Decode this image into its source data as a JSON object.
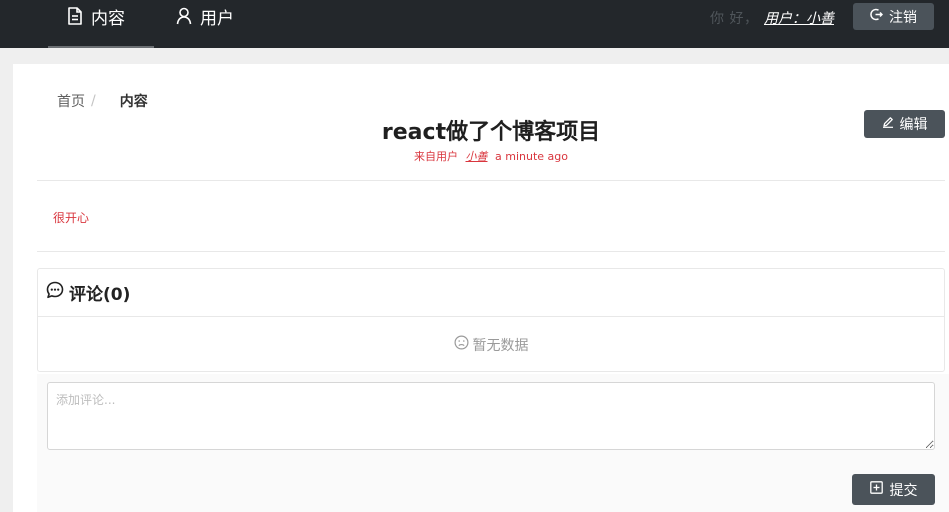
{
  "nav": {
    "content_label": "内容",
    "users_label": "用户",
    "greeting": "你 好，",
    "user_link": "用户：小善",
    "logout_label": "注销"
  },
  "breadcrumb": {
    "home": "首页",
    "separator": "/",
    "current": "内容"
  },
  "post": {
    "title": "react做了个博客项目",
    "meta_prefix": "来自用户",
    "author": "小善",
    "time": "a minute ago",
    "body": "很开心",
    "edit_label": "编辑"
  },
  "comments": {
    "header": "评论(0)",
    "empty_text": "暂无数据",
    "input_placeholder": "添加评论...",
    "submit_label": "提交"
  },
  "colors": {
    "topbar": "#23272b",
    "button": "#4b535a",
    "accent_red": "#d9363e"
  },
  "icons": {
    "content": "file-text-icon",
    "users": "user-icon",
    "logout": "logout-icon",
    "edit": "pencil-icon",
    "comments": "message-bubble-icon",
    "empty": "frown-icon",
    "submit": "plus-square-icon"
  }
}
